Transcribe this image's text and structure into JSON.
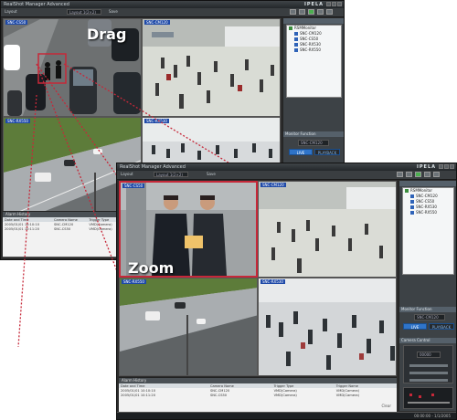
{
  "window1": {
    "title": "RealShot Manager Advanced",
    "brand": "IPELA",
    "toolbar": {
      "layout_label": "Layout",
      "layout_value": "Layout 1(2×2)",
      "save_label": "Save"
    },
    "cams": [
      {
        "label": "SNC-CS50",
        "scene": "parking"
      },
      {
        "label": "SNC-CM120",
        "scene": "concourse"
      },
      {
        "label": "SNC-RX550",
        "scene": "highway"
      },
      {
        "label": "SNC-RX530",
        "scene": "crowd"
      }
    ],
    "overlay": "Drag",
    "tree": {
      "root": "RSMMonitor",
      "items": [
        "SNC-CM120",
        "SNC-CS50",
        "SNC-RX530",
        "SNC-RX550"
      ]
    },
    "monitor_label": "Monitor Function",
    "monitor_select": "SNC-CM120",
    "live_label": "LIVE",
    "playback_label": "PLAYBACK",
    "alarm": {
      "title": "Alarm History",
      "columns": [
        "Date and Time",
        "Camera Name",
        "Trigger Type"
      ],
      "rows": [
        [
          "2005/01/01 10:10:10",
          "SNC-CM120",
          "VMD(Camera)"
        ],
        [
          "2005/01/01 10:11:20",
          "SNC-CS50",
          "VMD(Camera)"
        ]
      ]
    }
  },
  "window2": {
    "title": "RealShot Manager Advanced",
    "brand": "IPELA",
    "toolbar": {
      "layout_label": "Layout",
      "layout_value": "Layout 1(2×2)",
      "save_label": "Save"
    },
    "cams": [
      {
        "label": "SNC-CS50",
        "scene": "zoom-men"
      },
      {
        "label": "SNC-CM120",
        "scene": "concourse"
      },
      {
        "label": "SNC-RX550",
        "scene": "highway"
      },
      {
        "label": "SNC-RX530",
        "scene": "crowd"
      }
    ],
    "overlay": "Zoom",
    "tree": {
      "root": "RSMMonitor",
      "items": [
        "SNC-CM120",
        "SNC-CS50",
        "SNC-RX530",
        "SNC-RX550"
      ]
    },
    "monitor_label": "Monitor Function",
    "monitor_select": "SNC-CM120",
    "live_label": "LIVE",
    "playback_label": "PLAYBACK",
    "camera_control_label": "Camera Control",
    "ptz_value": "00000",
    "alarm": {
      "title": "Alarm History",
      "columns": [
        "Date and Time",
        "Camera Name",
        "Trigger Type",
        "Trigger Name"
      ],
      "rows": [
        [
          "2005/01/01 10:10:10",
          "SNC-CM120",
          "VMD(Camera)",
          "VMD(Camera)"
        ],
        [
          "2005/01/01 10:11:20",
          "SNC-CS50",
          "VMD(Camera)",
          "VMD(Camera)"
        ]
      ],
      "clear_label": "Clear"
    },
    "status_time": "00:00:00 - 1/1/2005"
  },
  "colors": {
    "selection": "#c62839",
    "panel": "#3d4246",
    "accent": "#2f74c9"
  }
}
